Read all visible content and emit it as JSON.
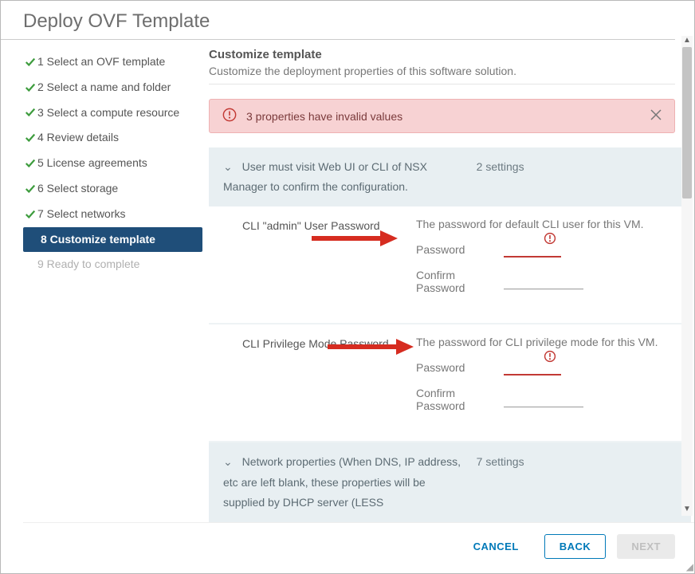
{
  "title": "Deploy OVF Template",
  "steps": [
    {
      "label": "1 Select an OVF template",
      "done": true
    },
    {
      "label": "2 Select a name and folder",
      "done": true
    },
    {
      "label": "3 Select a compute resource",
      "done": true
    },
    {
      "label": "4 Review details",
      "done": true
    },
    {
      "label": "5 License agreements",
      "done": true
    },
    {
      "label": "6 Select storage",
      "done": true
    },
    {
      "label": "7 Select networks",
      "done": true
    },
    {
      "label": "8 Customize template",
      "active": true
    },
    {
      "label": "9 Ready to complete",
      "disabled": true
    }
  ],
  "header": {
    "title": "Customize template",
    "subtitle": "Customize the deployment properties of this software solution."
  },
  "alert": {
    "text": "3 properties have invalid values"
  },
  "section1": {
    "title": "User must visit Web UI or CLI of NSX Manager to confirm the configuration.",
    "meta": "2 settings",
    "prop1": {
      "name": "CLI \"admin\" User Password",
      "desc": "The password for default CLI user for this VM.",
      "pw_label": "Password",
      "cpw_label": "Confirm Password"
    },
    "prop2": {
      "name": "CLI Privilege Mode Password",
      "desc": "The password for CLI privilege mode for this VM.",
      "pw_label": "Password",
      "cpw_label": "Confirm Password"
    }
  },
  "section2": {
    "title": "Network properties (When DNS, IP address, etc are left blank, these properties will be supplied by DHCP server (LESS",
    "meta": "7 settings"
  },
  "footer": {
    "cancel": "CANCEL",
    "back": "BACK",
    "next": "NEXT"
  }
}
